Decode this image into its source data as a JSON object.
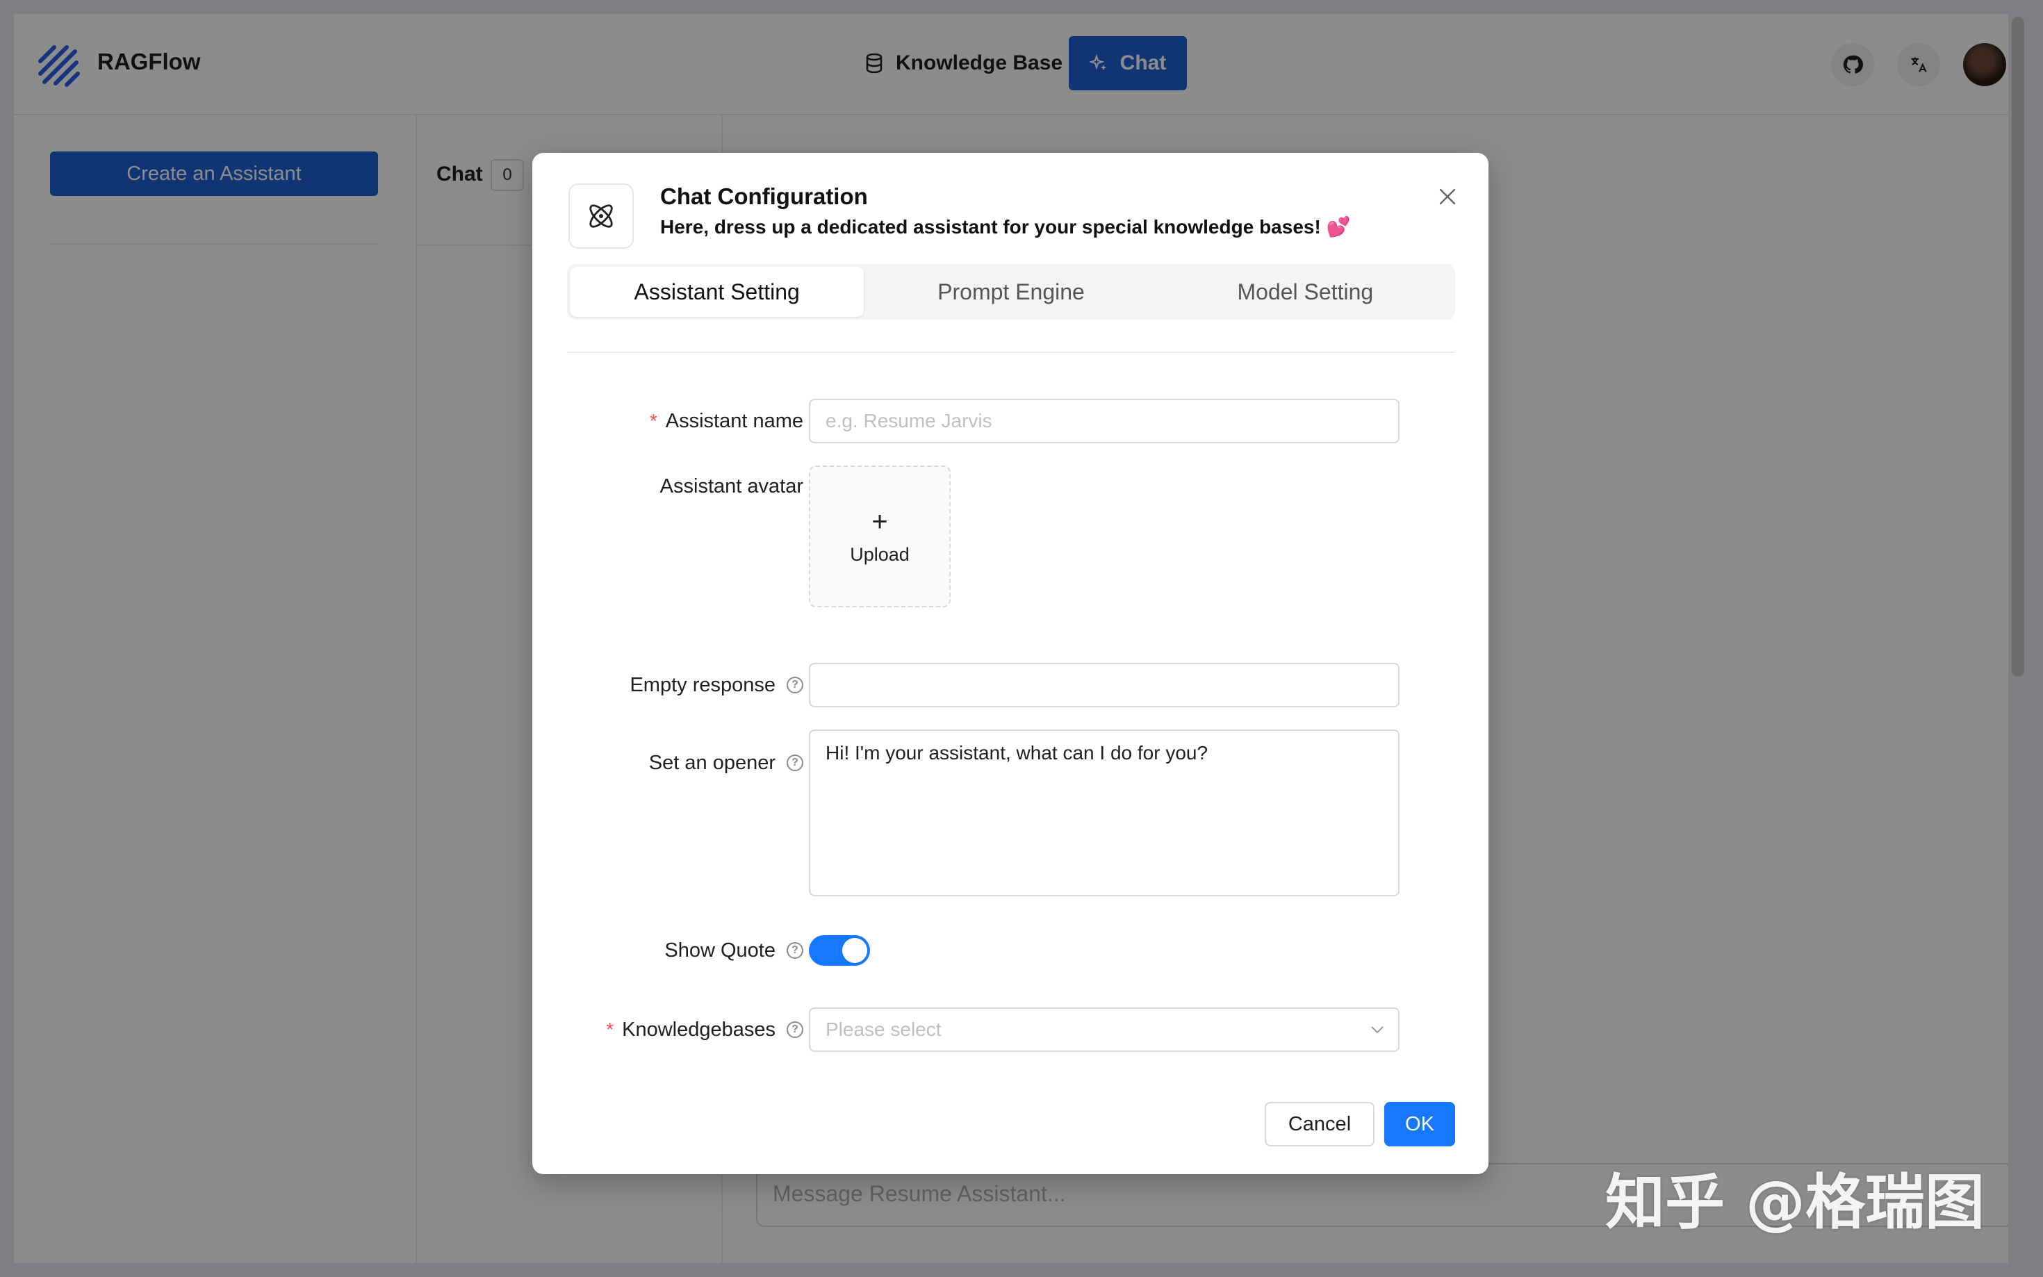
{
  "app": {
    "name": "RAGFlow",
    "nav": {
      "knowledge_base": "Knowledge Base",
      "chat": "Chat"
    }
  },
  "sidebar": {
    "create_button": "Create an Assistant"
  },
  "chat_list": {
    "title": "Chat",
    "count": "0"
  },
  "message_input": {
    "placeholder": "Message Resume Assistant..."
  },
  "modal": {
    "title": "Chat Configuration",
    "subtitle": "Here, dress up a dedicated assistant for your special knowledge bases! 💕",
    "tabs": [
      {
        "label": "Assistant Setting",
        "active": true
      },
      {
        "label": "Prompt Engine",
        "active": false
      },
      {
        "label": "Model Setting",
        "active": false
      }
    ],
    "form": {
      "assistant_name": {
        "label": "Assistant name",
        "placeholder": "e.g. Resume Jarvis",
        "required": true
      },
      "assistant_avatar": {
        "label": "Assistant avatar",
        "upload_label": "Upload"
      },
      "empty_response": {
        "label": "Empty response",
        "value": ""
      },
      "opener": {
        "label": "Set an opener",
        "value": "Hi! I'm your assistant, what can I do for you?"
      },
      "show_quote": {
        "label": "Show Quote",
        "enabled": true
      },
      "knowledgebases": {
        "label": "Knowledgebases",
        "placeholder": "Please select",
        "required": true
      }
    },
    "buttons": {
      "cancel": "Cancel",
      "ok": "OK"
    }
  },
  "watermark": "知乎 @格瑞图",
  "colors": {
    "primary": "#1f5fd6",
    "ok_button": "#1677ff",
    "required_star": "#ff4d4f"
  }
}
